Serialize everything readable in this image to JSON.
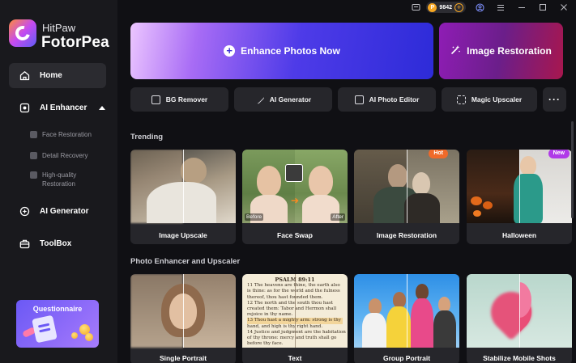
{
  "brand": {
    "sub": "HitPaw",
    "main": "FotorPea",
    "accent": "#7b5cf6"
  },
  "sidebar": {
    "home": "Home",
    "ai_enhancer": "AI Enhancer",
    "subitems": [
      "Face Restoration",
      "Detail Recovery",
      "High-quality Restoration"
    ],
    "ai_generator": "AI Generator",
    "toolbox": "ToolBox",
    "questionnaire": "Questionnaire"
  },
  "topbar": {
    "coins": "9842",
    "coin_symbol": "P",
    "icons": [
      "feedback-icon",
      "coin-icon",
      "add-coins-icon",
      "account-icon",
      "menu-icon",
      "minimize-icon",
      "maximize-icon",
      "close-icon"
    ]
  },
  "hero": {
    "main": "Enhance Photos Now",
    "restore": "Image Restoration"
  },
  "tools": [
    "BG Remover",
    "AI Generator",
    "AI Photo Editor",
    "Magic Upscaler"
  ],
  "sections": {
    "trending": "Trending",
    "enhancer": "Photo Enhancer and Upscaler"
  },
  "trending": [
    {
      "caption": "Image Upscale"
    },
    {
      "caption": "Face Swap",
      "before": "Before",
      "after": "After"
    },
    {
      "caption": "Image Restoration",
      "badge": "Hot",
      "badge_color": "#f06a2a"
    },
    {
      "caption": "Halloween",
      "badge": "New",
      "badge_color": "#b03ae8"
    }
  ],
  "enhancer": [
    {
      "caption": "Single Portrait"
    },
    {
      "caption": "Text"
    },
    {
      "caption": "Group Portrait"
    },
    {
      "caption": "Stabilize Mobile Shots"
    }
  ],
  "bible_text": {
    "heading": "PSALM 89:11",
    "lines": [
      "11 The heavens are thine, the earth also",
      "is thine: as for the world and the fulness",
      "thereof, thou hast founded them.",
      "12 The north and the south thou hast",
      "created them: Tabor and Hermon shall",
      "rejoice in thy name.",
      "13 Thou hast a mighty arm: strong is thy",
      "hand, and high is thy right hand.",
      "14 Justice and judgment are the habitation",
      "of thy throne: mercy and truth shall go",
      "before thy face."
    ]
  }
}
